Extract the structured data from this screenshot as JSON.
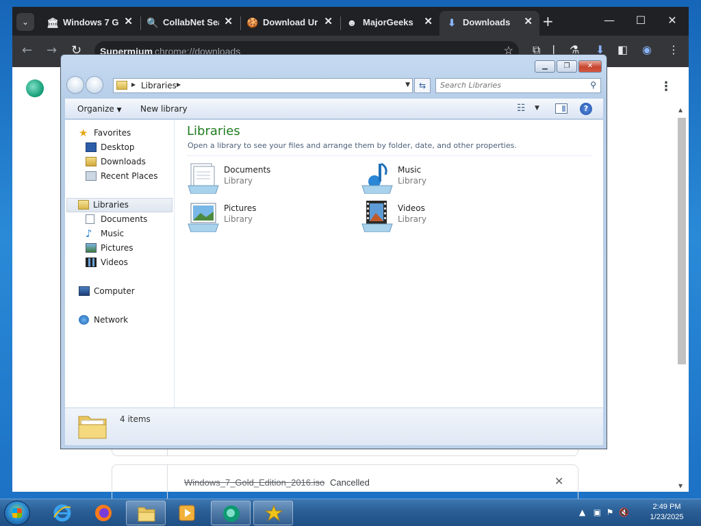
{
  "browser": {
    "tabs": [
      {
        "title": "Windows 7 G",
        "icon": "museum-icon"
      },
      {
        "title": "CollabNet Sea",
        "icon": "search-icon"
      },
      {
        "title": "Download Ur",
        "icon": "cookie-icon"
      },
      {
        "title": "MajorGeeks",
        "icon": "geek-icon"
      },
      {
        "title": "Downloads",
        "icon": "download-icon",
        "active": true
      }
    ],
    "omnibox": {
      "host": "Supermium",
      "url": "chrome://downloads"
    }
  },
  "downloads": {
    "item": {
      "filename": "Windows_7_Gold_Edition_2016.iso",
      "status": "Cancelled"
    }
  },
  "explorer": {
    "breadcrumb": "Libraries",
    "search_placeholder": "Search Libraries",
    "commands": {
      "organize": "Organize",
      "new_library": "New library"
    },
    "nav": {
      "favorites": "Favorites",
      "desktop": "Desktop",
      "downloads": "Downloads",
      "recent_places": "Recent Places",
      "libraries": "Libraries",
      "documents": "Documents",
      "music": "Music",
      "pictures": "Pictures",
      "videos": "Videos",
      "computer": "Computer",
      "network": "Network"
    },
    "content": {
      "title": "Libraries",
      "description": "Open a library to see your files and arrange them by folder, date, and other properties.",
      "libraries": [
        {
          "name": "Documents",
          "type": "Library"
        },
        {
          "name": "Music",
          "type": "Library"
        },
        {
          "name": "Pictures",
          "type": "Library"
        },
        {
          "name": "Videos",
          "type": "Library"
        }
      ]
    },
    "details": {
      "count": "4 items"
    }
  },
  "taskbar": {
    "clock": {
      "time": "2:49 PM",
      "date": "1/23/2025"
    }
  },
  "colors": {
    "library_title": "#1e7b1e",
    "chrome_dark": "#202124",
    "taskbar": "#2a5e95"
  }
}
